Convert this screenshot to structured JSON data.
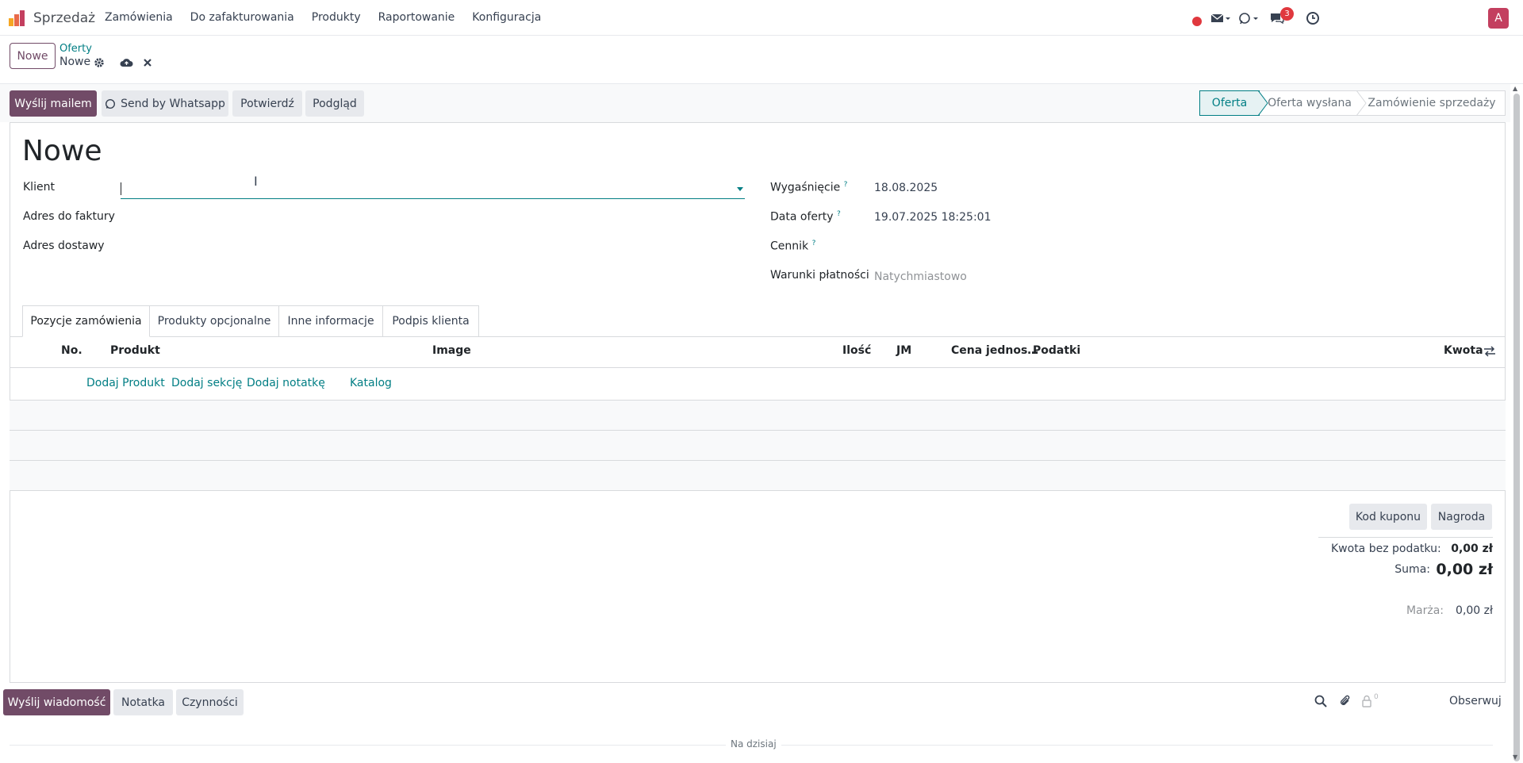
{
  "navbar": {
    "app_name": "Sprzedaż",
    "menu": [
      "Zamówienia",
      "Do zafakturowania",
      "Produkty",
      "Raportowanie",
      "Konfiguracja"
    ],
    "messages_badge": "3",
    "avatar_letter": "A"
  },
  "control_panel": {
    "new_label": "Nowe",
    "breadcrumb_parent": "Oferty",
    "breadcrumb_current": "Nowe"
  },
  "actions": {
    "email": "Wyślij mailem",
    "whatsapp": "Send by Whatsapp",
    "confirm": "Potwierdź",
    "preview": "Podgląd"
  },
  "statusbar": [
    "Oferta",
    "Oferta wysłana",
    "Zamówienie sprzedaży"
  ],
  "form": {
    "title": "Nowe",
    "left": {
      "client_label": "Klient",
      "client_value": "",
      "invoice_address_label": "Adres do faktury",
      "delivery_address_label": "Adres dostawy"
    },
    "right": {
      "expiration_label": "Wygaśnięcie",
      "expiration_value": "18.08.2025",
      "quote_date_label": "Data oferty",
      "quote_date_value": "19.07.2025 18:25:01",
      "pricelist_label": "Cennik",
      "payment_terms_label": "Warunki płatności",
      "payment_terms_value": "Natychmiastowo"
    },
    "help_mark": "?"
  },
  "tabs": [
    "Pozycje zamówienia",
    "Produkty opcjonalne",
    "Inne informacje",
    "Podpis klienta"
  ],
  "table": {
    "headers": {
      "no": "No.",
      "product": "Produkt",
      "image": "Image",
      "qty": "Ilość",
      "uom": "JM",
      "unit_price": "Cena jednos…",
      "taxes": "Podatki",
      "amount": "Kwota"
    },
    "add_links": {
      "product": "Dodaj Produkt",
      "section": "Dodaj sekcję",
      "note": "Dodaj notatkę",
      "catalog": "Katalog"
    }
  },
  "totals": {
    "coupon_btn": "Kod kuponu",
    "reward_btn": "Nagroda",
    "untaxed_label": "Kwota bez podatku:",
    "untaxed_value": "0,00 zł",
    "total_label": "Suma:",
    "total_value": "0,00 zł",
    "margin_label": "Marża:",
    "margin_value": "0,00 zł"
  },
  "chatter": {
    "send_message": "Wyślij wiadomość",
    "note": "Notatka",
    "activities": "Czynności",
    "followers_count": "0",
    "follow": "Obserwuj",
    "today": "Na dzisiaj"
  },
  "colors": {
    "primary": "#714b67",
    "accent": "#017e84",
    "badge": "#e0383e"
  }
}
